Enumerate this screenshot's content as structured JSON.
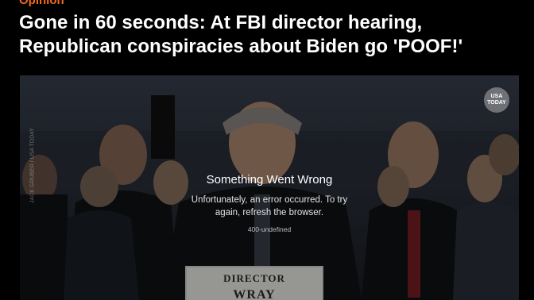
{
  "article": {
    "section": "Opinion",
    "headline": "Gone in 60 seconds: At FBI director hearing, Republican conspiracies about Biden go 'POOF!'"
  },
  "video": {
    "logo_line1": "USA",
    "logo_line2": "TODAY",
    "credit": "JACK GRUBER / USA TODAY",
    "nameplate_line1": "DIRECTOR",
    "nameplate_line2": "WRAY",
    "error": {
      "title": "Something Went Wrong",
      "message": "Unfortunately, an error occurred. To try again, refresh the browser.",
      "code": "400-undefined"
    }
  }
}
